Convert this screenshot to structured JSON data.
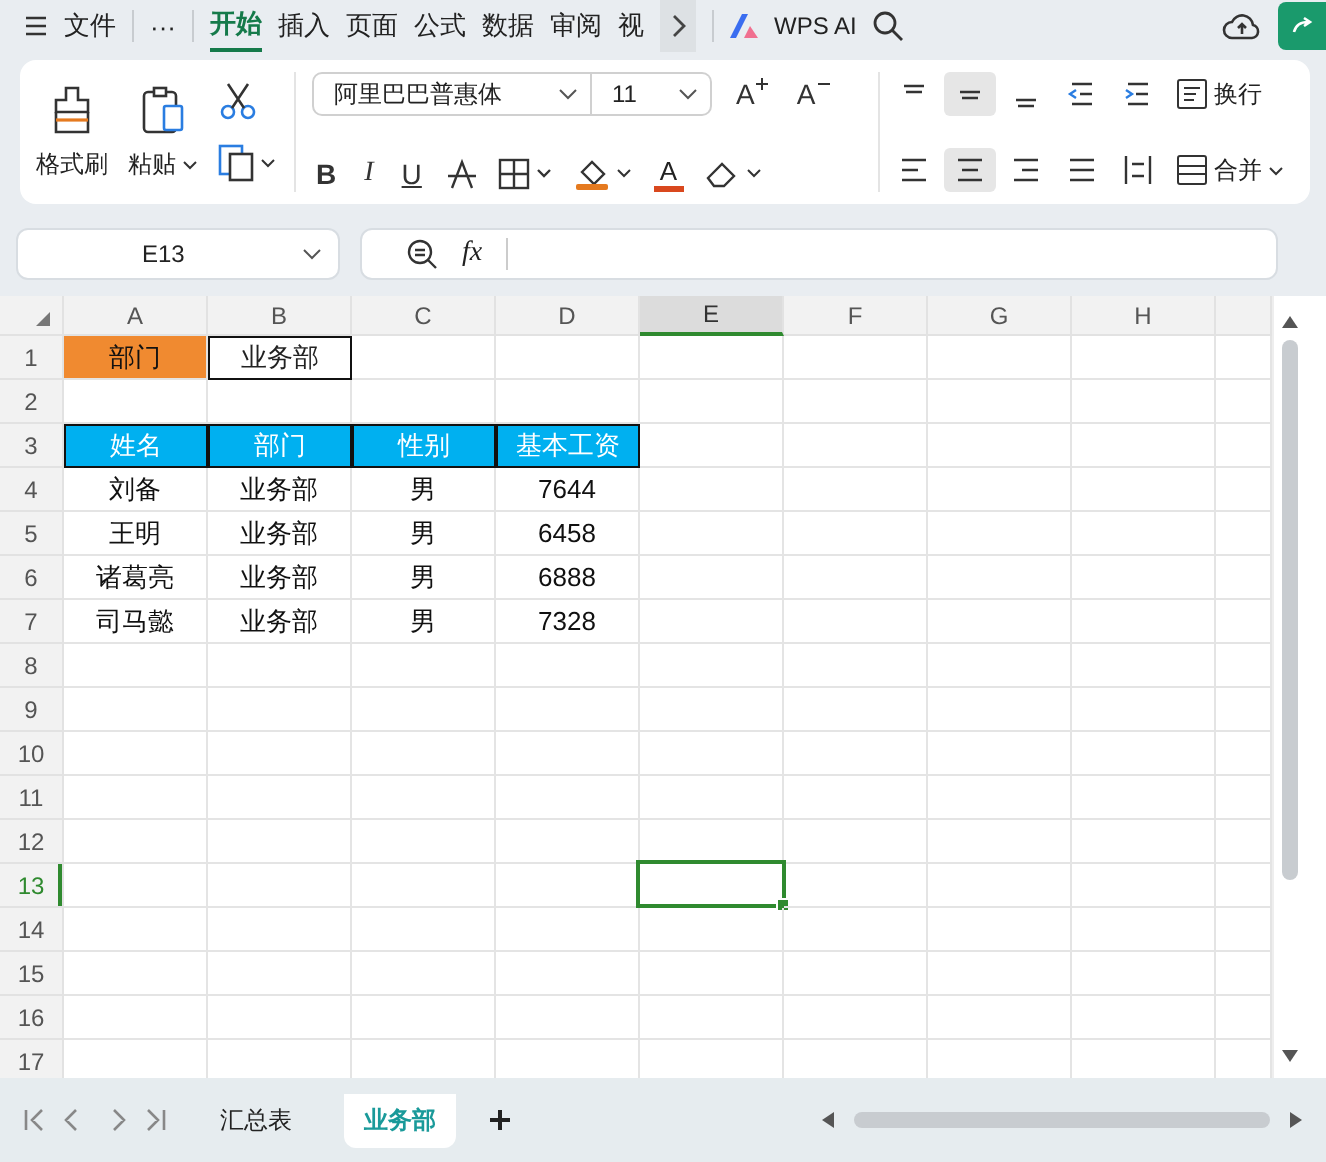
{
  "menu": {
    "file": "文件",
    "more": "···",
    "tabs": [
      {
        "label": "开始",
        "selected": true
      },
      {
        "label": "插入",
        "selected": false
      },
      {
        "label": "页面",
        "selected": false
      },
      {
        "label": "公式",
        "selected": false
      },
      {
        "label": "数据",
        "selected": false
      },
      {
        "label": "审阅",
        "selected": false
      },
      {
        "label": "视",
        "selected": false
      }
    ],
    "ai": "WPS AI"
  },
  "ribbon": {
    "format_painter": "格式刷",
    "paste": "粘贴",
    "font": "阿里巴巴普惠体",
    "size": "11",
    "grow": "A",
    "shrink": "A",
    "bold": "B",
    "italic": "I",
    "underline": "U",
    "font_color": "A",
    "wrap": "换行",
    "merge": "合并"
  },
  "formula_bar": {
    "cell": "E13",
    "fx": "fx"
  },
  "columns": [
    {
      "label": "A",
      "selected": false
    },
    {
      "label": "B",
      "selected": false
    },
    {
      "label": "C",
      "selected": false
    },
    {
      "label": "D",
      "selected": false
    },
    {
      "label": "E",
      "selected": true
    },
    {
      "label": "F",
      "selected": false
    },
    {
      "label": "G",
      "selected": false
    },
    {
      "label": "H",
      "selected": false
    }
  ],
  "rows": [
    {
      "num": "1",
      "selected": false,
      "cells": [
        {
          "text": "部门",
          "kind": "tag"
        },
        {
          "text": "业务部",
          "kind": "boxed"
        }
      ]
    },
    {
      "num": "2",
      "selected": false,
      "cells": []
    },
    {
      "num": "3",
      "selected": false,
      "cells": [
        {
          "text": "姓名",
          "kind": "head"
        },
        {
          "text": "部门",
          "kind": "head"
        },
        {
          "text": "性别",
          "kind": "head"
        },
        {
          "text": "基本工资",
          "kind": "head"
        }
      ]
    },
    {
      "num": "4",
      "selected": false,
      "cells": [
        {
          "text": "刘备",
          "kind": "plain"
        },
        {
          "text": "业务部",
          "kind": "plain"
        },
        {
          "text": "男",
          "kind": "plain"
        },
        {
          "text": "7644",
          "kind": "plain"
        }
      ]
    },
    {
      "num": "5",
      "selected": false,
      "cells": [
        {
          "text": "王明",
          "kind": "plain"
        },
        {
          "text": "业务部",
          "kind": "plain"
        },
        {
          "text": "男",
          "kind": "plain"
        },
        {
          "text": "6458",
          "kind": "plain"
        }
      ]
    },
    {
      "num": "6",
      "selected": false,
      "cells": [
        {
          "text": "诸葛亮",
          "kind": "plain"
        },
        {
          "text": "业务部",
          "kind": "plain"
        },
        {
          "text": "男",
          "kind": "plain"
        },
        {
          "text": "6888",
          "kind": "plain"
        }
      ]
    },
    {
      "num": "7",
      "selected": false,
      "cells": [
        {
          "text": "司马懿",
          "kind": "plain"
        },
        {
          "text": "业务部",
          "kind": "plain"
        },
        {
          "text": "男",
          "kind": "plain"
        },
        {
          "text": "7328",
          "kind": "plain"
        }
      ]
    },
    {
      "num": "8",
      "selected": false,
      "cells": []
    },
    {
      "num": "9",
      "selected": false,
      "cells": []
    },
    {
      "num": "10",
      "selected": false,
      "cells": []
    },
    {
      "num": "11",
      "selected": false,
      "cells": []
    },
    {
      "num": "12",
      "selected": false,
      "cells": []
    },
    {
      "num": "13",
      "selected": true,
      "cells": []
    },
    {
      "num": "14",
      "selected": false,
      "cells": []
    },
    {
      "num": "15",
      "selected": false,
      "cells": []
    },
    {
      "num": "16",
      "selected": false,
      "cells": []
    },
    {
      "num": "17",
      "selected": false,
      "cells": []
    }
  ],
  "sheets": [
    {
      "label": "汇总表",
      "selected": false
    },
    {
      "label": "业务部",
      "selected": true
    }
  ]
}
